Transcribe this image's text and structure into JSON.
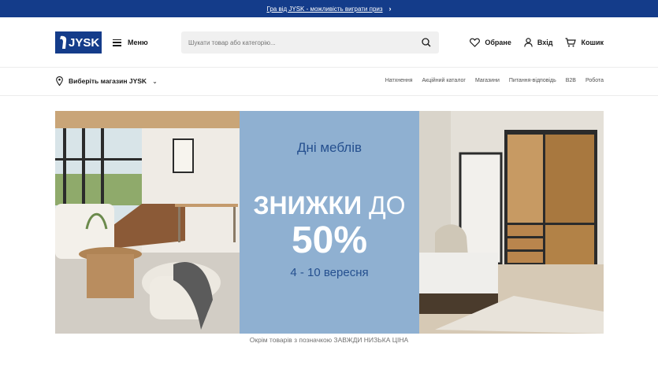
{
  "promo": {
    "text": "Гра від JYSK - можливість виграти приз"
  },
  "header": {
    "logo_text": "JYSK",
    "menu_label": "Меню",
    "search_placeholder": "Шукати товар або категорію...",
    "favorites_label": "Обране",
    "login_label": "Вхід",
    "cart_label": "Кошик"
  },
  "subnav": {
    "store_label": "Виберіть магазин JYSK",
    "links": [
      "Натхнення",
      "Акційний каталог",
      "Магазини",
      "Питання-відповідь",
      "B2B",
      "Робота"
    ]
  },
  "banner": {
    "headline": "Дні меблів",
    "discount_word": "ЗНИЖКИ",
    "discount_prep": "ДО",
    "discount_value": "50%",
    "dates": "4 - 10 вересня",
    "accent_color": "#8fb0d1"
  },
  "disclaimer": "Окрім товарів з позначкою ЗАВЖДИ НИЗЬКА ЦІНА",
  "colors": {
    "brand": "#143c8a"
  }
}
